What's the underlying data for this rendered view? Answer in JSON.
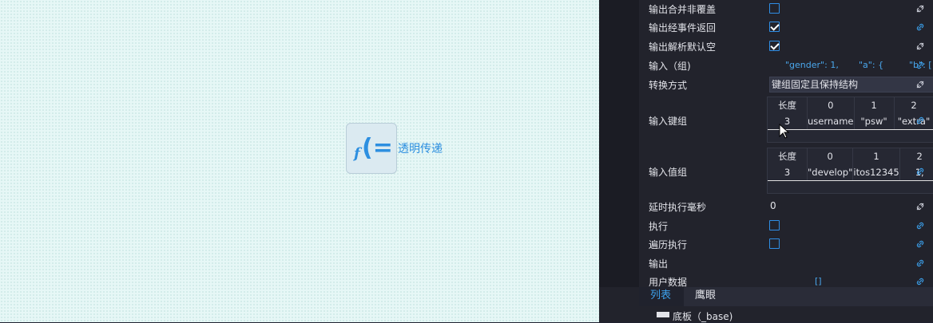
{
  "node": {
    "icon": "function-icon",
    "label": "透明传递",
    "glyph_f": "f",
    "glyph_eq": "(=)"
  },
  "props": {
    "out_merge": {
      "label": "输出合并非覆盖",
      "checked": false
    },
    "out_event": {
      "label": "输出经事件返回",
      "checked": true
    },
    "out_parse": {
      "label": "输出解析默认空",
      "checked": true
    },
    "input_group": {
      "label": "输入（组)",
      "v1": "\"gender\": 1,",
      "v2": "\"a\": {",
      "v3": "\"b\": ["
    },
    "convert": {
      "label": "转换方式",
      "value": "键组固定且保持结构"
    },
    "keys": {
      "label": "输入键组",
      "headers": [
        "长度",
        "0",
        "1",
        "2"
      ],
      "values": [
        "3",
        "username",
        "\"psw\"",
        "\"extra\""
      ]
    },
    "vals": {
      "label": "输入值组",
      "headers": [
        "长度",
        "0",
        "1",
        "2"
      ],
      "values": [
        "3",
        "\"develop\"",
        "itos12345",
        "1,"
      ]
    },
    "delay": {
      "label": "延时执行毫秒",
      "value": "0"
    },
    "execute": {
      "label": "执行",
      "checked": false
    },
    "iterate": {
      "label": "遍历执行",
      "checked": false
    },
    "output": {
      "label": "输出"
    },
    "user_data": {
      "label": "用户数据",
      "value": "[]"
    }
  },
  "tabs": {
    "list": "列表",
    "hawkeye": "鹰眼"
  },
  "tree": {
    "item": "底板（_base)"
  }
}
